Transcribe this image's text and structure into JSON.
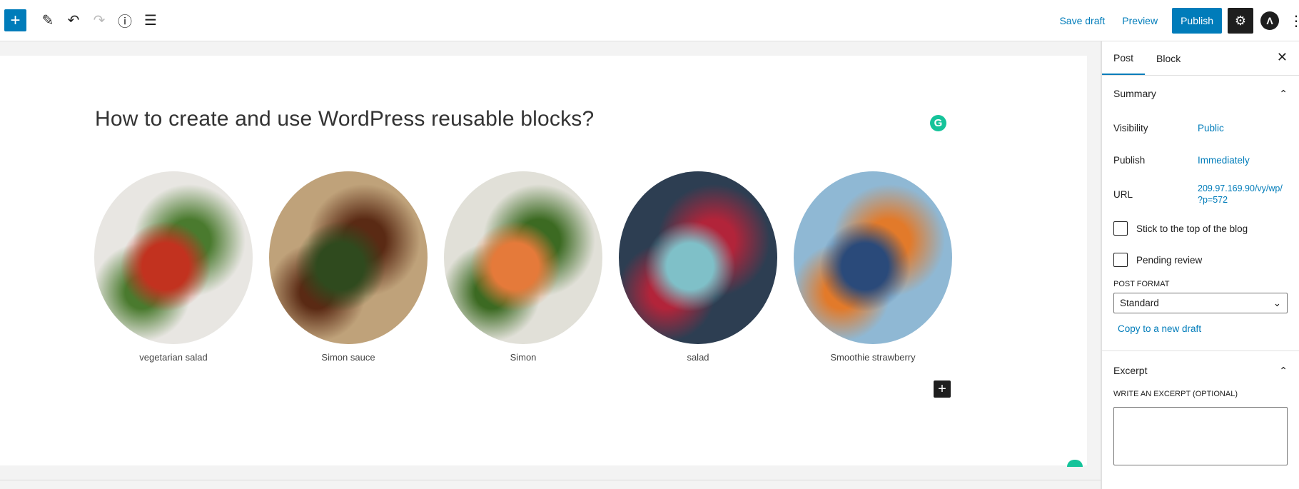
{
  "toolbar": {
    "add_label": "+",
    "tools": [
      "pencil-icon",
      "undo-icon",
      "redo-icon",
      "info-icon",
      "list-view-icon"
    ],
    "save_draft": "Save draft",
    "preview": "Preview",
    "publish": "Publish",
    "avatar": "Λ",
    "more": "⋮"
  },
  "editor": {
    "title": "How to create and use WordPress reusable blocks?",
    "gallery": [
      {
        "caption": "vegetarian salad",
        "colors": [
          "#e8e6e2",
          "#c2321f",
          "#4a7a2e"
        ]
      },
      {
        "caption": "Simon sauce",
        "colors": [
          "#bfa27a",
          "#2f4a1e",
          "#5a2a14"
        ]
      },
      {
        "caption": "Simon",
        "colors": [
          "#e1e0d8",
          "#e57a3a",
          "#3c6a22"
        ]
      },
      {
        "caption": "salad",
        "colors": [
          "#2d3e52",
          "#7fc0c8",
          "#b2243a"
        ]
      },
      {
        "caption": "Smoothie strawberry",
        "colors": [
          "#8fb8d4",
          "#2a4a7a",
          "#e27a2a"
        ]
      }
    ]
  },
  "sidebar": {
    "tabs": [
      "Post",
      "Block"
    ],
    "summary": {
      "title": "Summary",
      "visibility_label": "Visibility",
      "visibility_value": "Public",
      "publish_label": "Publish",
      "publish_value": "Immediately",
      "url_label": "URL",
      "url_value_1": "209.97.169.90/vy/wp/",
      "url_value_2": "?p=572",
      "stick_label": "Stick to the top of the blog",
      "pending_label": "Pending review",
      "post_format_label": "POST FORMAT",
      "post_format_value": "Standard",
      "copy_link": "Copy to a new draft"
    },
    "excerpt": {
      "title": "Excerpt",
      "label": "WRITE AN EXCERPT (OPTIONAL)",
      "value": ""
    }
  }
}
